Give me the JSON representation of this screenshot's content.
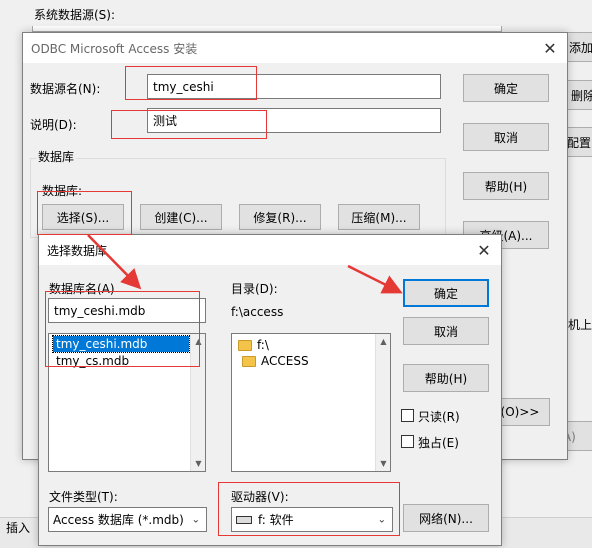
{
  "bg": {
    "sys_source_label": "系统数据源(S):",
    "right_btn_add": "添加",
    "right_btn_delete": "删除",
    "right_btn_config": "配置",
    "right_text_machine": "机上",
    "right_btn_apply": "应用(A)",
    "status_insert": "插入"
  },
  "odbc": {
    "title": "ODBC Microsoft Access 安装",
    "dsn_label": "数据源名(N):",
    "dsn_value": "tmy_ceshi",
    "desc_label": "说明(D):",
    "desc_value": "测试",
    "db_group_label": "数据库",
    "db_label": "数据库:",
    "btn_select": "选择(S)...",
    "btn_create": "创建(C)...",
    "btn_repair": "修复(R)...",
    "btn_compact": "压缩(M)...",
    "btn_ok": "确定",
    "btn_cancel": "取消",
    "btn_help": "帮助(H)",
    "btn_advanced": "高级(A)...",
    "btn_options": "(O)>>"
  },
  "select_db": {
    "title": "选择数据库",
    "dbname_label": "数据库名(A)",
    "dbname_value": "tmy_ceshi.mdb",
    "files": [
      "tmy_ceshi.mdb",
      "tmy_cs.mdb"
    ],
    "dir_label": "目录(D):",
    "dir_value": "f:\\access",
    "dirs": [
      "f:\\",
      "ACCESS"
    ],
    "btn_ok": "确定",
    "btn_cancel": "取消",
    "btn_help": "帮助(H)",
    "readonly_label": "只读(R)",
    "exclusive_label": "独占(E)",
    "filetype_label": "文件类型(T):",
    "filetype_value": "Access 数据库 (*.mdb)",
    "drive_label": "驱动器(V):",
    "drive_value": "f: 软件",
    "btn_network": "网络(N)..."
  },
  "colors": {
    "accent": "#0078d7",
    "annotation": "#e53935",
    "selection": "#0078d7"
  }
}
